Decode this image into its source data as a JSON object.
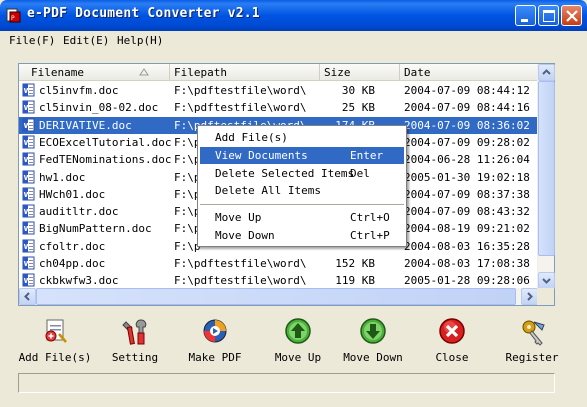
{
  "window": {
    "title": "e-PDF Document Converter v2.1"
  },
  "menubar": [
    {
      "label": "File(F)"
    },
    {
      "label": "Edit(E)"
    },
    {
      "label": "Help(H)"
    }
  ],
  "table": {
    "columns": [
      "Filename",
      "Filepath",
      "Size",
      "Date"
    ],
    "rows": [
      {
        "filename": "cl5invfm.doc",
        "filepath": "F:\\pdftestfile\\word\\",
        "size": "30 KB",
        "date": "2004-07-09 08:44:12",
        "selected": false
      },
      {
        "filename": "cl5invin_08-02.doc",
        "filepath": "F:\\pdftestfile\\word\\",
        "size": "25 KB",
        "date": "2004-07-09 08:44:16",
        "selected": false
      },
      {
        "filename": "DERIVATIVE.doc",
        "filepath": "F:\\pdftestfile\\word\\",
        "size": "174 KB",
        "date": "2004-07-09 08:36:02",
        "selected": true
      },
      {
        "filename": "ECOExcelTutorial.doc",
        "filepath": "F:\\p",
        "size": "",
        "date": "2004-07-09 09:28:02",
        "selected": false
      },
      {
        "filename": "FedTENominations.doc",
        "filepath": "F:\\p",
        "size": "",
        "date": "2004-06-28 11:26:04",
        "selected": false
      },
      {
        "filename": "hw1.doc",
        "filepath": "F:\\p",
        "size": "",
        "date": "2005-01-30 19:02:18",
        "selected": false
      },
      {
        "filename": "HWch01.doc",
        "filepath": "F:\\p",
        "size": "",
        "date": "2004-07-09 08:37:38",
        "selected": false
      },
      {
        "filename": "auditltr.doc",
        "filepath": "F:\\p",
        "size": "",
        "date": "2004-07-09 08:43:32",
        "selected": false
      },
      {
        "filename": "BigNumPattern.doc",
        "filepath": "F:\\p",
        "size": "",
        "date": "2004-08-19 09:21:02",
        "selected": false
      },
      {
        "filename": "cfoltr.doc",
        "filepath": "F:\\p",
        "size": "",
        "date": "2004-08-03 16:35:28",
        "selected": false
      },
      {
        "filename": "ch04pp.doc",
        "filepath": "F:\\pdftestfile\\word\\",
        "size": "152 KB",
        "date": "2004-08-03 17:08:38",
        "selected": false
      },
      {
        "filename": "ckbkwfw3.doc",
        "filepath": "F:\\pdftestfile\\word\\",
        "size": "119 KB",
        "date": "2005-01-28 09:28:06",
        "selected": false
      }
    ]
  },
  "context_menu": {
    "items": [
      {
        "label": "Add File(s)",
        "shortcut": "",
        "highlighted": false
      },
      {
        "label": "View Documents",
        "shortcut": "Enter",
        "highlighted": true
      },
      {
        "label": "Delete Selected Items",
        "shortcut": "Del",
        "highlighted": false
      },
      {
        "label": "Delete All Items",
        "shortcut": "",
        "highlighted": false
      },
      {
        "label": "Move Up",
        "shortcut": "Ctrl+O",
        "highlighted": false
      },
      {
        "label": "Move Down",
        "shortcut": "Ctrl+P",
        "highlighted": false
      }
    ]
  },
  "toolbar": {
    "buttons": [
      {
        "label": "Add File(s)",
        "icon": "add-files-icon"
      },
      {
        "label": "Setting",
        "icon": "tools-icon"
      },
      {
        "label": "Make PDF",
        "icon": "make-pdf-icon"
      },
      {
        "label": "Move Up",
        "icon": "arrow-up-icon"
      },
      {
        "label": "Move Down",
        "icon": "arrow-down-icon"
      },
      {
        "label": "Close",
        "icon": "close-icon"
      },
      {
        "label": "Register",
        "icon": "register-icon"
      }
    ]
  },
  "colors": {
    "titlebar": "#0054e3",
    "selection": "#316ac5",
    "window_bg": "#ece9d8"
  }
}
